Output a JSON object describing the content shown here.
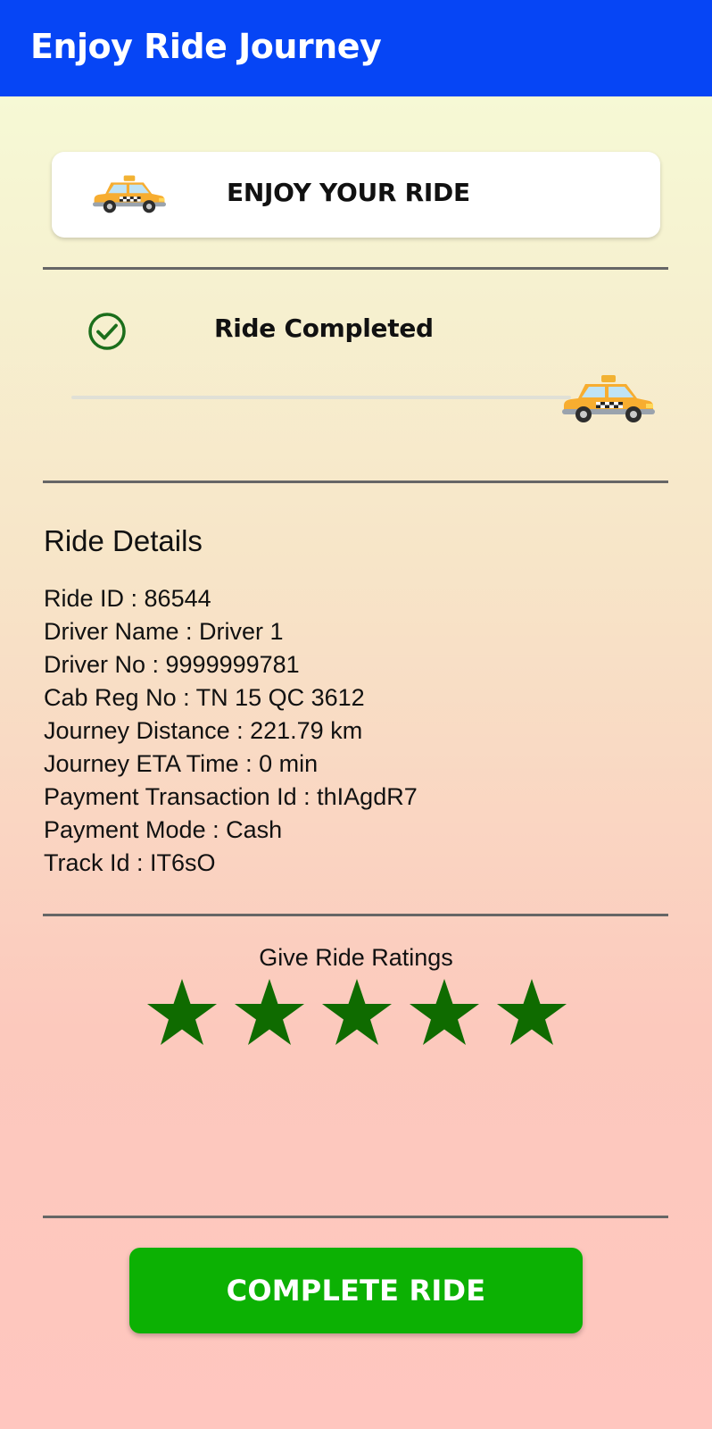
{
  "app_bar": {
    "title": "Enjoy Ride Journey",
    "background_color": "#0645f5"
  },
  "ride_card": {
    "title": "ENJOY YOUR RIDE",
    "icon": "taxi-icon"
  },
  "status": {
    "label": "Ride Completed",
    "icon": "check-circle-icon",
    "icon_color": "#1b6e1b",
    "progress": 1.0,
    "progress_icon": "taxi-icon"
  },
  "ride_details": {
    "heading": "Ride Details",
    "lines": [
      "Ride ID : 86544",
      "Driver Name : Driver 1",
      "Driver No : 9999999781",
      "Cab Reg No : TN 15 QC 3612",
      "Journey Distance : 221.79 km",
      "Journey ETA Time :  0 min",
      "Payment Transaction Id : thIAgdR7",
      "Payment Mode : Cash",
      "Track Id : IT6sO"
    ]
  },
  "ratings": {
    "label": "Give Ride Ratings",
    "value": 5,
    "max": 5,
    "star_color": "#0f6b00"
  },
  "complete_button": {
    "label": "COMPLETE RIDE",
    "color": "#0cb103"
  }
}
